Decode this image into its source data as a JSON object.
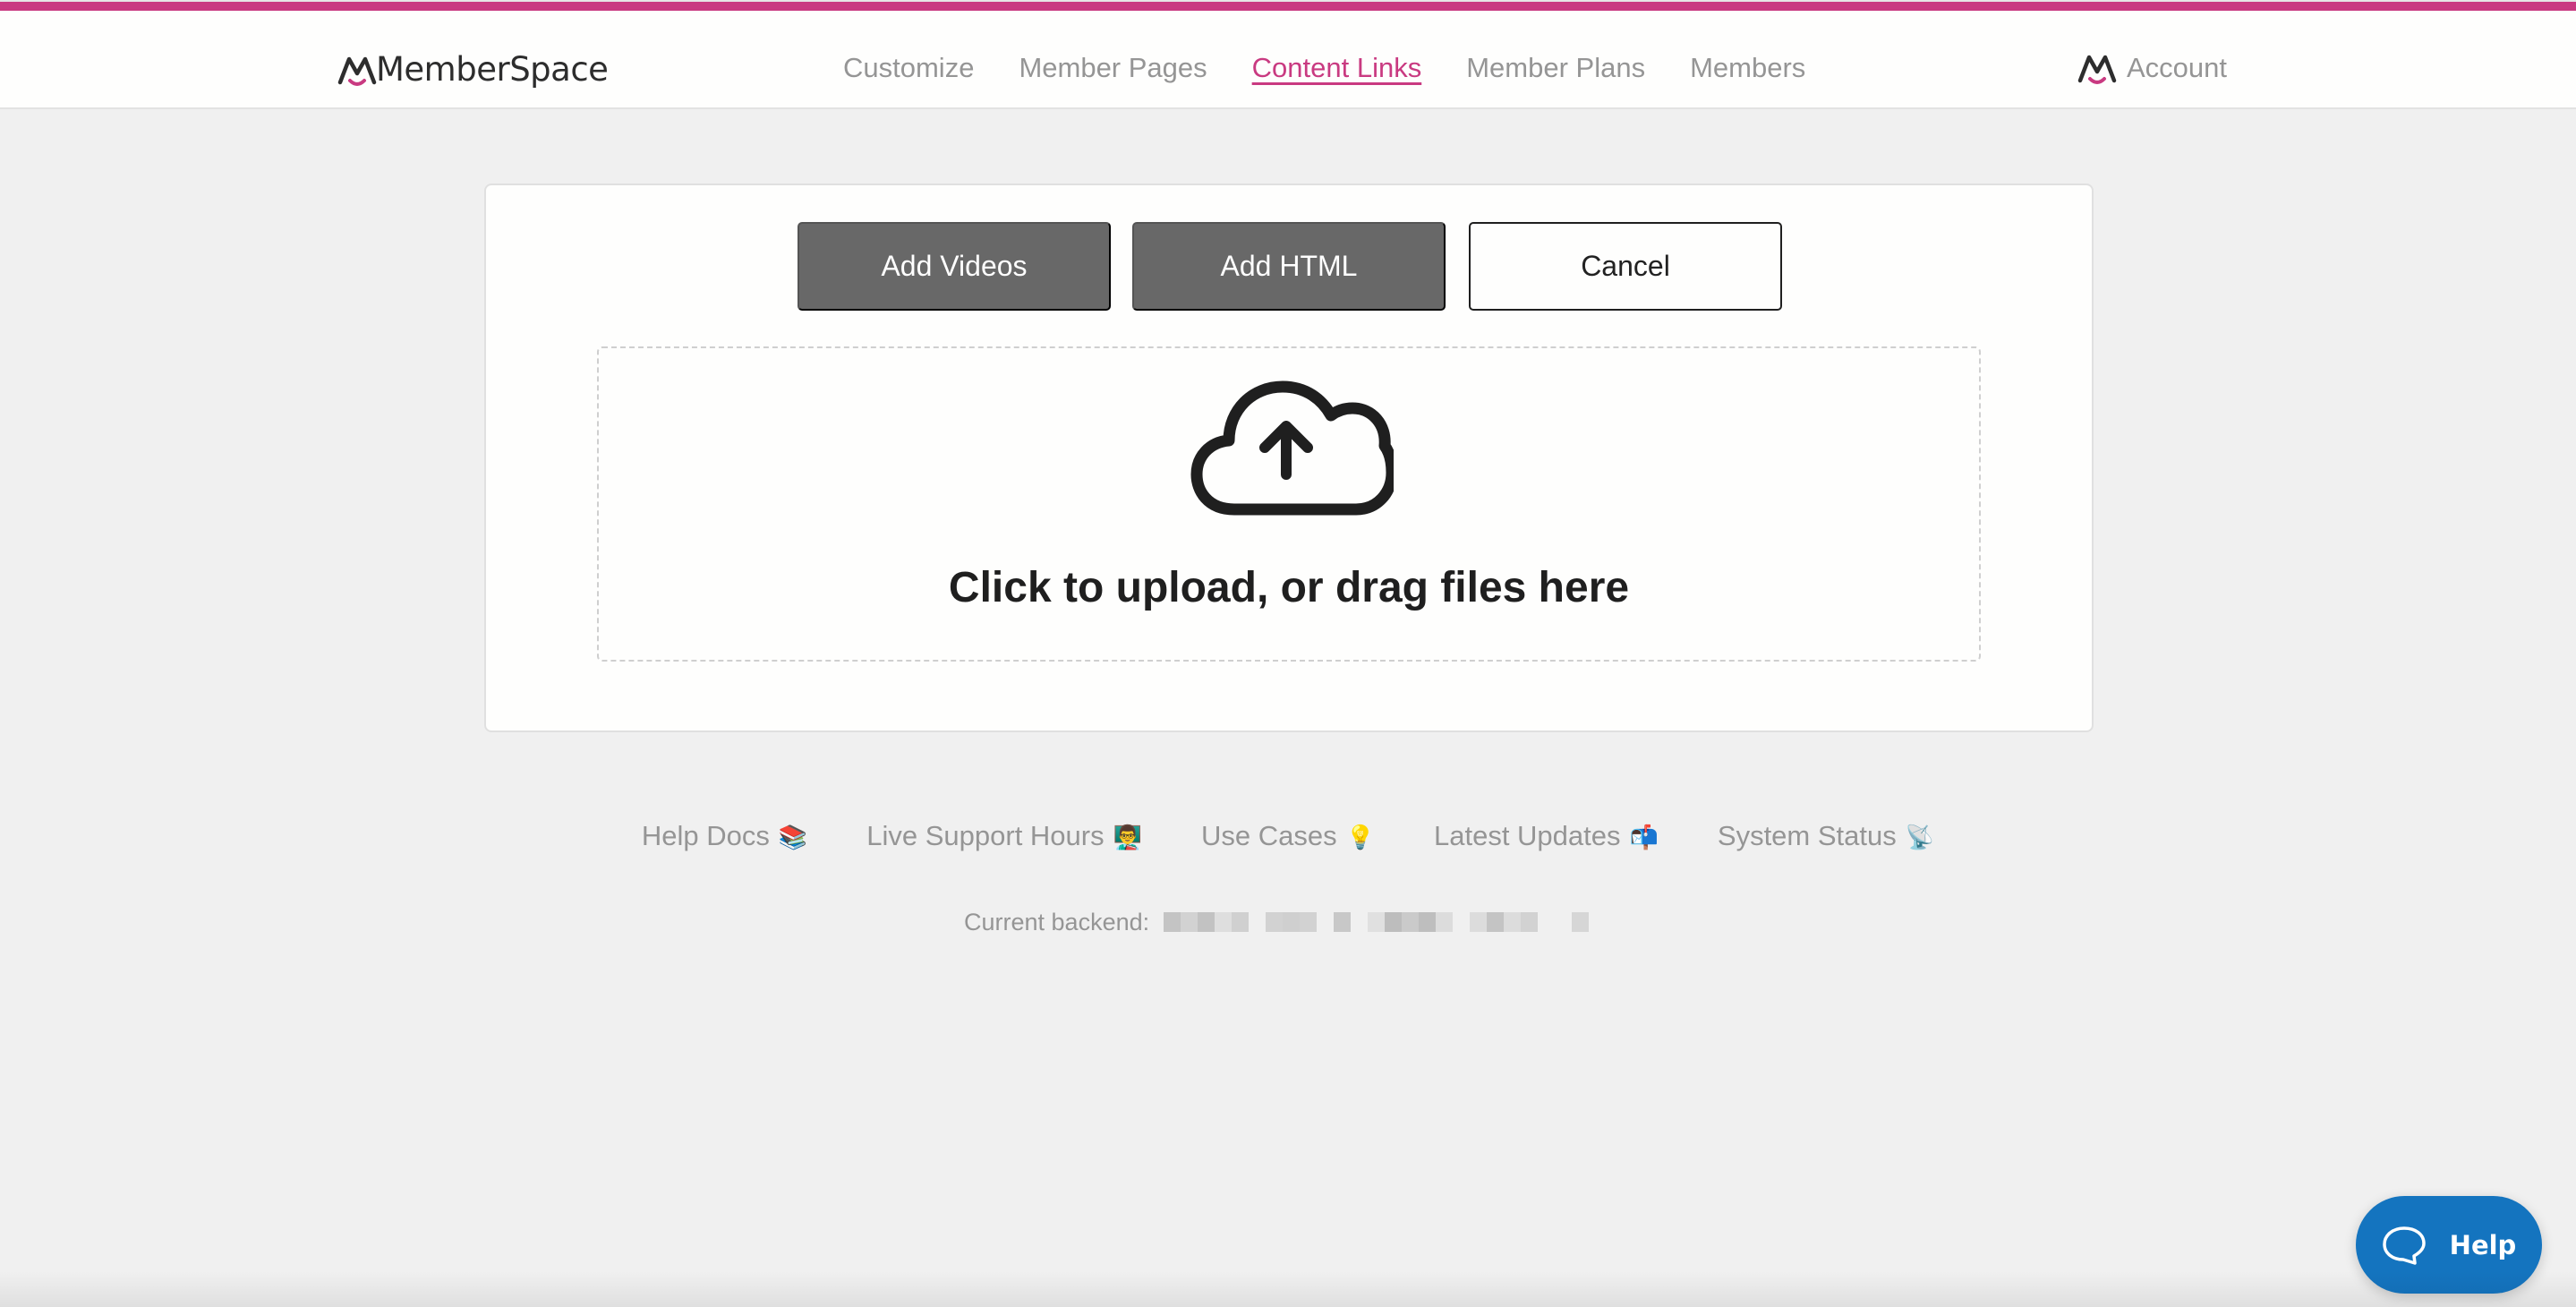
{
  "header": {
    "brand": "MemberSpace",
    "nav": [
      {
        "label": "Customize",
        "active": false
      },
      {
        "label": "Member Pages",
        "active": false
      },
      {
        "label": "Content Links",
        "active": true
      },
      {
        "label": "Member Plans",
        "active": false
      },
      {
        "label": "Members",
        "active": false
      }
    ],
    "account_label": "Account",
    "accent_color": "#c93a81"
  },
  "toolbar": {
    "add_videos_label": "Add Videos",
    "add_html_label": "Add HTML",
    "cancel_label": "Cancel"
  },
  "dropzone": {
    "icon": "cloud-upload-icon",
    "text": "Click to upload, or drag files here"
  },
  "footer": {
    "links": [
      {
        "label": "Help Docs",
        "emoji": "📚"
      },
      {
        "label": "Live Support Hours",
        "emoji": "👨‍🏫"
      },
      {
        "label": "Use Cases",
        "emoji": "💡"
      },
      {
        "label": "Latest Updates",
        "emoji": "📬"
      },
      {
        "label": "System Status",
        "emoji": "📡"
      }
    ],
    "backend_label": "Current backend:",
    "backend_value": "[redacted]"
  },
  "help_widget": {
    "label": "Help",
    "icon": "chat-bubble-icon",
    "color": "#1474bf"
  }
}
